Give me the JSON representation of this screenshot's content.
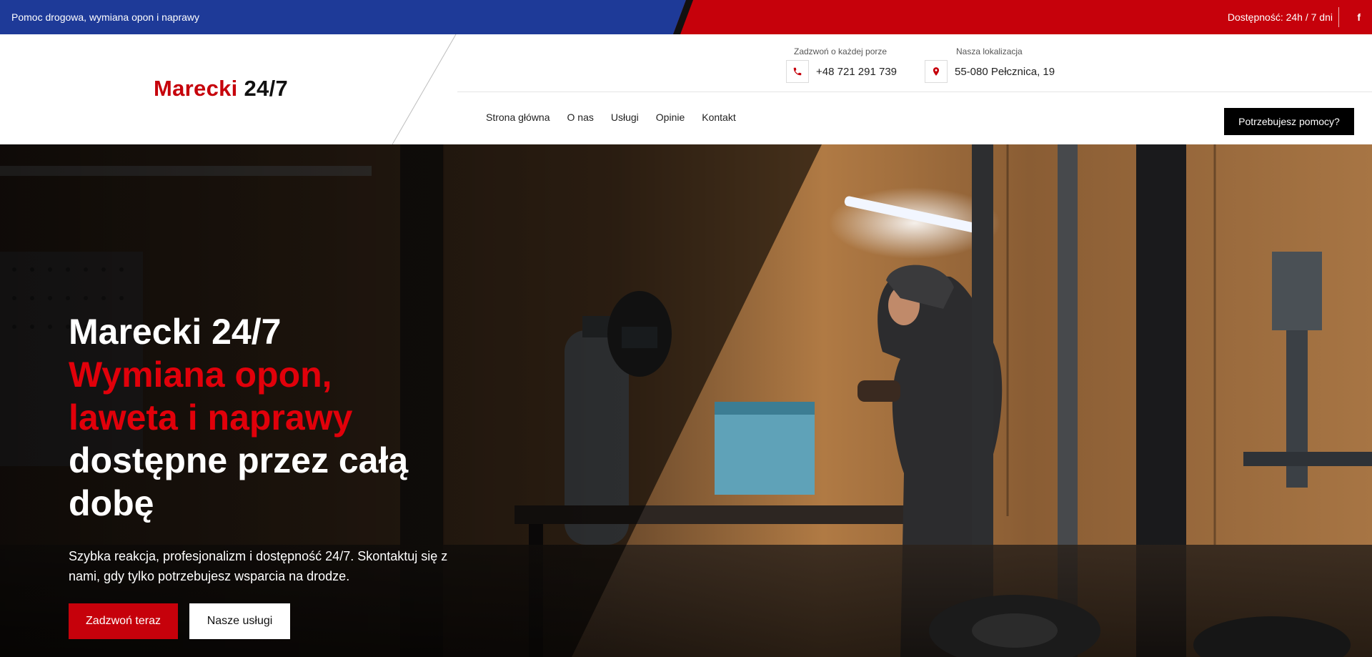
{
  "topbar": {
    "left_text": "Pomoc drogowa, wymiana opon i naprawy",
    "right_text": "Dostępność: 24h / 7 dni",
    "facebook_glyph": "f",
    "icon": "facebook-icon"
  },
  "logo": {
    "part1": "Marecki",
    "part2": "24/7"
  },
  "contact": {
    "phone_caption": "Zadzwoń o każdej porze",
    "phone_value": "+48 721 291 739",
    "phone_icon": "phone-icon",
    "location_caption": "Nasza lokalizacja",
    "location_value": "55-080 Pełcznica, 19",
    "location_icon": "map-pin-icon"
  },
  "nav": {
    "items": [
      "Strona główna",
      "O nas",
      "Usługi",
      "Opinie",
      "Kontakt"
    ]
  },
  "cta_button": "Potrzebujesz pomocy?",
  "hero": {
    "title_line1": "Marecki 24/7",
    "title_line2": "Wymiana opon,",
    "title_line3": "laweta i naprawy",
    "title_line4": "dostępne przez całą",
    "title_line5": "dobę",
    "description": "Szybka reakcja, profesjonalizm i dostępność 24/7. Skontaktuj się z nami, gdy tylko potrzebujesz wsparcia na drodze.",
    "primary_button": "Zadzwoń teraz",
    "secondary_button": "Nasze usługi"
  },
  "colors": {
    "brand_red": "#c6010b",
    "brand_blue": "#1e3a98",
    "dark": "#111111"
  }
}
